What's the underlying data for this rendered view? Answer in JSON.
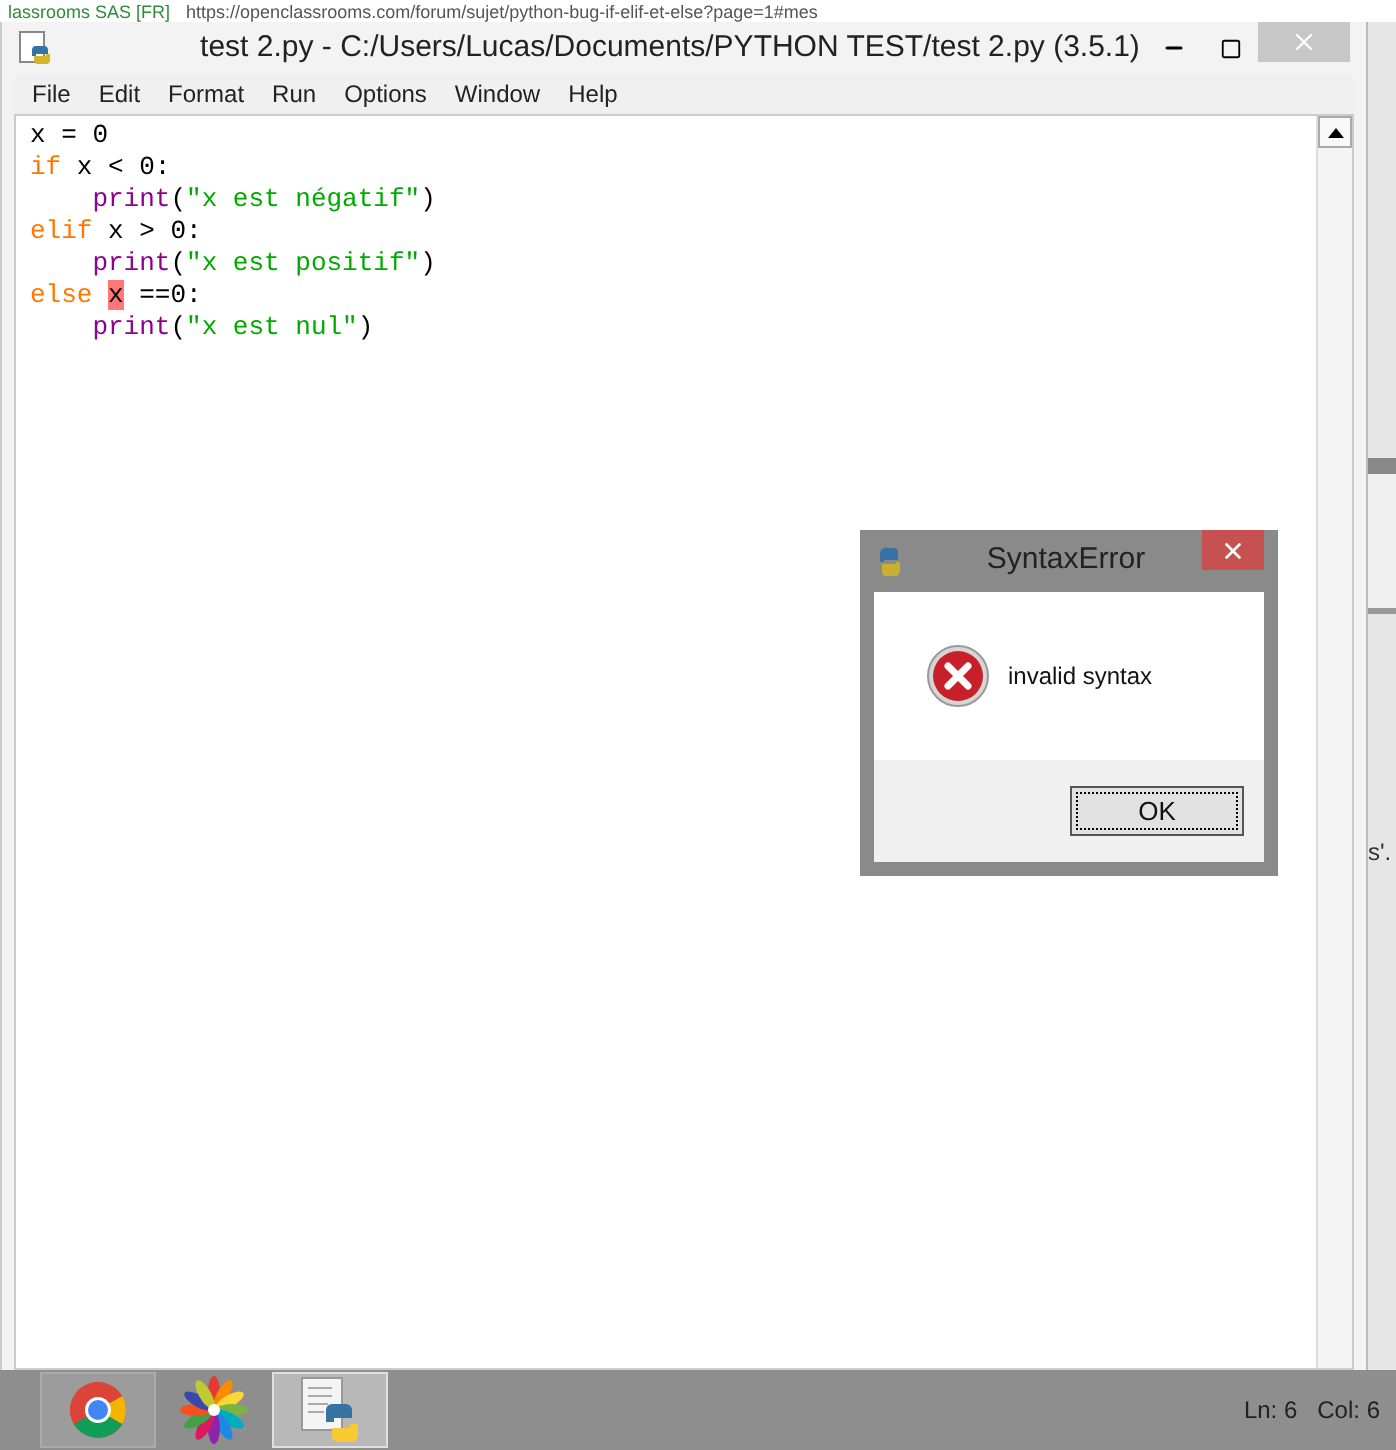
{
  "browser_strip": {
    "site": "lassrooms SAS [FR]",
    "url": "https://openclassrooms.com/forum/sujet/python-bug-if-elif-et-else?page=1#mes"
  },
  "window": {
    "title": "test 2.py - C:/Users/Lucas/Documents/PYTHON TEST/test 2.py (3.5.1)"
  },
  "menu": [
    "File",
    "Edit",
    "Format",
    "Run",
    "Options",
    "Window",
    "Help"
  ],
  "code_lines": [
    {
      "indented": false,
      "tokens": [
        {
          "text": "x = 0",
          "kind": "plain"
        }
      ]
    },
    {
      "indented": false,
      "tokens": [
        {
          "text": "if",
          "kind": "keyword"
        },
        {
          "text": " x < 0:",
          "kind": "plain"
        }
      ]
    },
    {
      "indented": true,
      "tokens": [
        {
          "text": "print",
          "kind": "builtin"
        },
        {
          "text": "(",
          "kind": "plain"
        },
        {
          "text": "\"x est négatif\"",
          "kind": "string"
        },
        {
          "text": ")",
          "kind": "plain"
        }
      ]
    },
    {
      "indented": false,
      "tokens": [
        {
          "text": "elif",
          "kind": "keyword"
        },
        {
          "text": " x > 0:",
          "kind": "plain"
        }
      ]
    },
    {
      "indented": true,
      "tokens": [
        {
          "text": "print",
          "kind": "builtin"
        },
        {
          "text": "(",
          "kind": "plain"
        },
        {
          "text": "\"x est positif\"",
          "kind": "string"
        },
        {
          "text": ")",
          "kind": "plain"
        }
      ]
    },
    {
      "indented": false,
      "tokens": [
        {
          "text": "else",
          "kind": "keyword"
        },
        {
          "text": "x",
          "kind": "error",
          "space_before": true
        },
        {
          "text": " ==0:",
          "kind": "plain"
        }
      ]
    },
    {
      "indented": true,
      "tokens": [
        {
          "text": "print",
          "kind": "builtin"
        },
        {
          "text": "(",
          "kind": "plain"
        },
        {
          "text": "\"x est nul\"",
          "kind": "string"
        },
        {
          "text": ")",
          "kind": "plain"
        }
      ]
    }
  ],
  "dialog": {
    "title": "SyntaxError",
    "message": "invalid syntax",
    "button": "OK"
  },
  "background_text": "s'.",
  "taskbar": [
    {
      "kind": "browser",
      "selected": false
    },
    {
      "kind": "flower",
      "selected": false
    },
    {
      "kind": "python",
      "selected": true
    }
  ],
  "status_bar": {
    "line": "Ln: 6",
    "column": "Col: 6"
  }
}
